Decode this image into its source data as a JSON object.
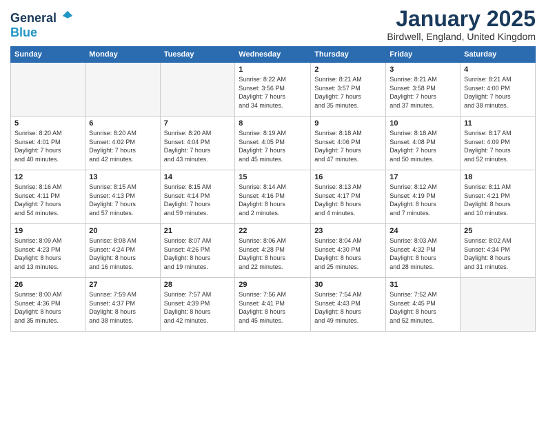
{
  "header": {
    "logo_line1": "General",
    "logo_line2": "Blue",
    "title": "January 2025",
    "location": "Birdwell, England, United Kingdom"
  },
  "days_of_week": [
    "Sunday",
    "Monday",
    "Tuesday",
    "Wednesday",
    "Thursday",
    "Friday",
    "Saturday"
  ],
  "weeks": [
    [
      {
        "day": "",
        "info": ""
      },
      {
        "day": "",
        "info": ""
      },
      {
        "day": "",
        "info": ""
      },
      {
        "day": "1",
        "info": "Sunrise: 8:22 AM\nSunset: 3:56 PM\nDaylight: 7 hours\nand 34 minutes."
      },
      {
        "day": "2",
        "info": "Sunrise: 8:21 AM\nSunset: 3:57 PM\nDaylight: 7 hours\nand 35 minutes."
      },
      {
        "day": "3",
        "info": "Sunrise: 8:21 AM\nSunset: 3:58 PM\nDaylight: 7 hours\nand 37 minutes."
      },
      {
        "day": "4",
        "info": "Sunrise: 8:21 AM\nSunset: 4:00 PM\nDaylight: 7 hours\nand 38 minutes."
      }
    ],
    [
      {
        "day": "5",
        "info": "Sunrise: 8:20 AM\nSunset: 4:01 PM\nDaylight: 7 hours\nand 40 minutes."
      },
      {
        "day": "6",
        "info": "Sunrise: 8:20 AM\nSunset: 4:02 PM\nDaylight: 7 hours\nand 42 minutes."
      },
      {
        "day": "7",
        "info": "Sunrise: 8:20 AM\nSunset: 4:04 PM\nDaylight: 7 hours\nand 43 minutes."
      },
      {
        "day": "8",
        "info": "Sunrise: 8:19 AM\nSunset: 4:05 PM\nDaylight: 7 hours\nand 45 minutes."
      },
      {
        "day": "9",
        "info": "Sunrise: 8:18 AM\nSunset: 4:06 PM\nDaylight: 7 hours\nand 47 minutes."
      },
      {
        "day": "10",
        "info": "Sunrise: 8:18 AM\nSunset: 4:08 PM\nDaylight: 7 hours\nand 50 minutes."
      },
      {
        "day": "11",
        "info": "Sunrise: 8:17 AM\nSunset: 4:09 PM\nDaylight: 7 hours\nand 52 minutes."
      }
    ],
    [
      {
        "day": "12",
        "info": "Sunrise: 8:16 AM\nSunset: 4:11 PM\nDaylight: 7 hours\nand 54 minutes."
      },
      {
        "day": "13",
        "info": "Sunrise: 8:15 AM\nSunset: 4:13 PM\nDaylight: 7 hours\nand 57 minutes."
      },
      {
        "day": "14",
        "info": "Sunrise: 8:15 AM\nSunset: 4:14 PM\nDaylight: 7 hours\nand 59 minutes."
      },
      {
        "day": "15",
        "info": "Sunrise: 8:14 AM\nSunset: 4:16 PM\nDaylight: 8 hours\nand 2 minutes."
      },
      {
        "day": "16",
        "info": "Sunrise: 8:13 AM\nSunset: 4:17 PM\nDaylight: 8 hours\nand 4 minutes."
      },
      {
        "day": "17",
        "info": "Sunrise: 8:12 AM\nSunset: 4:19 PM\nDaylight: 8 hours\nand 7 minutes."
      },
      {
        "day": "18",
        "info": "Sunrise: 8:11 AM\nSunset: 4:21 PM\nDaylight: 8 hours\nand 10 minutes."
      }
    ],
    [
      {
        "day": "19",
        "info": "Sunrise: 8:09 AM\nSunset: 4:23 PM\nDaylight: 8 hours\nand 13 minutes."
      },
      {
        "day": "20",
        "info": "Sunrise: 8:08 AM\nSunset: 4:24 PM\nDaylight: 8 hours\nand 16 minutes."
      },
      {
        "day": "21",
        "info": "Sunrise: 8:07 AM\nSunset: 4:26 PM\nDaylight: 8 hours\nand 19 minutes."
      },
      {
        "day": "22",
        "info": "Sunrise: 8:06 AM\nSunset: 4:28 PM\nDaylight: 8 hours\nand 22 minutes."
      },
      {
        "day": "23",
        "info": "Sunrise: 8:04 AM\nSunset: 4:30 PM\nDaylight: 8 hours\nand 25 minutes."
      },
      {
        "day": "24",
        "info": "Sunrise: 8:03 AM\nSunset: 4:32 PM\nDaylight: 8 hours\nand 28 minutes."
      },
      {
        "day": "25",
        "info": "Sunrise: 8:02 AM\nSunset: 4:34 PM\nDaylight: 8 hours\nand 31 minutes."
      }
    ],
    [
      {
        "day": "26",
        "info": "Sunrise: 8:00 AM\nSunset: 4:36 PM\nDaylight: 8 hours\nand 35 minutes."
      },
      {
        "day": "27",
        "info": "Sunrise: 7:59 AM\nSunset: 4:37 PM\nDaylight: 8 hours\nand 38 minutes."
      },
      {
        "day": "28",
        "info": "Sunrise: 7:57 AM\nSunset: 4:39 PM\nDaylight: 8 hours\nand 42 minutes."
      },
      {
        "day": "29",
        "info": "Sunrise: 7:56 AM\nSunset: 4:41 PM\nDaylight: 8 hours\nand 45 minutes."
      },
      {
        "day": "30",
        "info": "Sunrise: 7:54 AM\nSunset: 4:43 PM\nDaylight: 8 hours\nand 49 minutes."
      },
      {
        "day": "31",
        "info": "Sunrise: 7:52 AM\nSunset: 4:45 PM\nDaylight: 8 hours\nand 52 minutes."
      },
      {
        "day": "",
        "info": ""
      }
    ]
  ]
}
